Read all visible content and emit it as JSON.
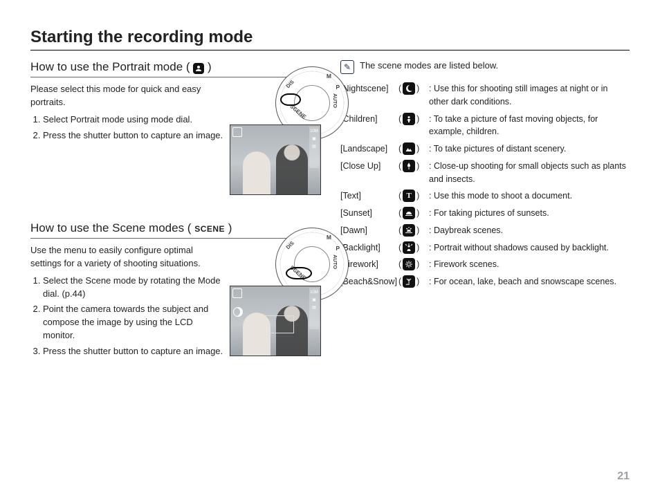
{
  "page": {
    "title": "Starting the recording mode",
    "number": "21"
  },
  "portrait": {
    "heading_pre": "How to use the Portrait mode ( ",
    "heading_post": " )",
    "intro": "Please select this mode for quick and easy portraits.",
    "step1": "Select Portrait mode using mode dial.",
    "step2": "Press the shutter button to capture an image.",
    "dial_labels": {
      "m": "M",
      "p": "P",
      "auto": "AUTO",
      "scene": "SCENE",
      "dis": "DIS"
    },
    "hud_value": "10M"
  },
  "scene": {
    "heading_pre": "How to use the Scene modes ( ",
    "heading_label": "SCENE",
    "heading_post": " )",
    "intro": "Use the menu to easily configure optimal settings for a variety of shooting situations.",
    "step1": "Select the Scene mode by rotating the Mode dial. (p.44)",
    "step2": "Point the camera towards the subject and compose the image by using the LCD monitor.",
    "step3": "Press the shutter button to capture an image.",
    "dial_labels": {
      "m": "M",
      "p": "P",
      "auto": "AUTO",
      "scene": "SCENE",
      "dis": "DIS"
    },
    "hud_value": "10M"
  },
  "scene_intro": "The scene modes are listed below.",
  "scenes": [
    {
      "name": "[Nightscene]",
      "iconKey": "night",
      "desc": "Use this for shooting still images at night or in other dark conditions."
    },
    {
      "name": "[Children]",
      "iconKey": "children",
      "desc": "To take a picture of fast moving objects, for example, children."
    },
    {
      "name": "[Landscape]",
      "iconKey": "landscape",
      "desc": "To take pictures of distant scenery."
    },
    {
      "name": "[Close Up]",
      "iconKey": "closeup",
      "desc": "Close-up shooting for small objects such as plants and insects."
    },
    {
      "name": "[Text]",
      "iconKey": "text",
      "desc": "Use this mode to shoot a document."
    },
    {
      "name": "[Sunset]",
      "iconKey": "sunset",
      "desc": "For taking pictures of sunsets."
    },
    {
      "name": "[Dawn]",
      "iconKey": "dawn",
      "desc": "Daybreak scenes."
    },
    {
      "name": "[Backlight]",
      "iconKey": "backlight",
      "desc": "Portrait without shadows caused by backlight."
    },
    {
      "name": "[Firework]",
      "iconKey": "firework",
      "desc": "Firework scenes."
    },
    {
      "name": "[Beach&Snow]",
      "iconKey": "beachsnow",
      "desc": "For ocean, lake, beach and snowscape scenes."
    }
  ],
  "glyphs": {
    "colon": ": ",
    "paren_open": "( ",
    "paren_close": " )"
  }
}
